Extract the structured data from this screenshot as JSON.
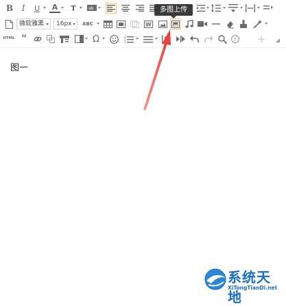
{
  "toolbar": {
    "font_family": "微软雅黑",
    "font_size": "16px",
    "tooltip": "多图上传",
    "abc_label": "ABC",
    "html_label": "HTML"
  },
  "editor": {
    "content": "图一"
  },
  "watermark": {
    "title": "系统天地",
    "url": "XiTongTianDi.net"
  },
  "colors": {
    "accent_active": "#f0c88a",
    "arrow": "#e8423f",
    "watermark_blue": "#1a6fc4"
  }
}
